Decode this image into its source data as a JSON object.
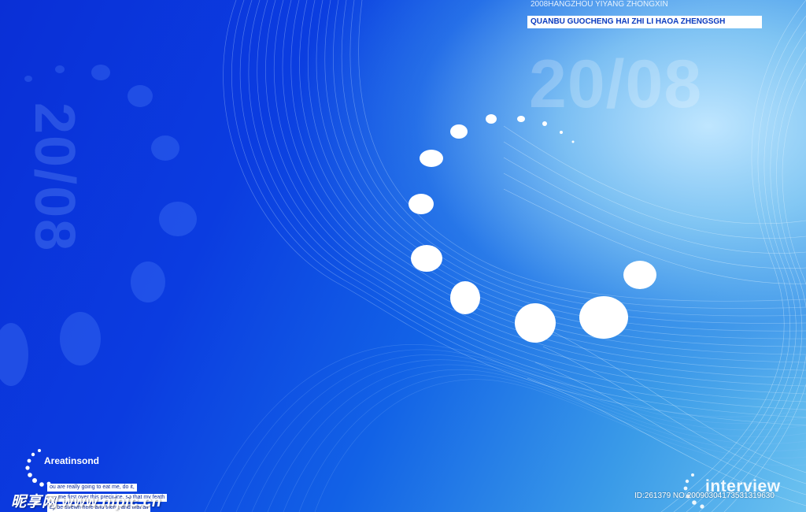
{
  "background_colors": {
    "deep_blue": "#0a2fd6",
    "mid_blue": "#1262e6",
    "light_cyan": "#bfe6ff",
    "dot_white": "#ffffff"
  },
  "decorative": {
    "vertical_year": "20/08",
    "horizontal_year": "20/08"
  },
  "header": {
    "line1": "2008HANGZHOU YIYANG ZHONGXIN",
    "line2": "QUANBU GUOCHENG HAI ZHI LI HAOA ZHENGSGH"
  },
  "brand": {
    "name": "Areatinsond",
    "lines": [
      "ou are really going to eat me, do it,",
      "...y me first over this precipice, so that my feath",
      "ay be strewn here and there, and that all"
    ]
  },
  "watermark": {
    "text": "昵享网 www.nipic.cn",
    "id": "ID:261379 NO:20090304173531319630"
  },
  "label": {
    "interview": "interview"
  }
}
